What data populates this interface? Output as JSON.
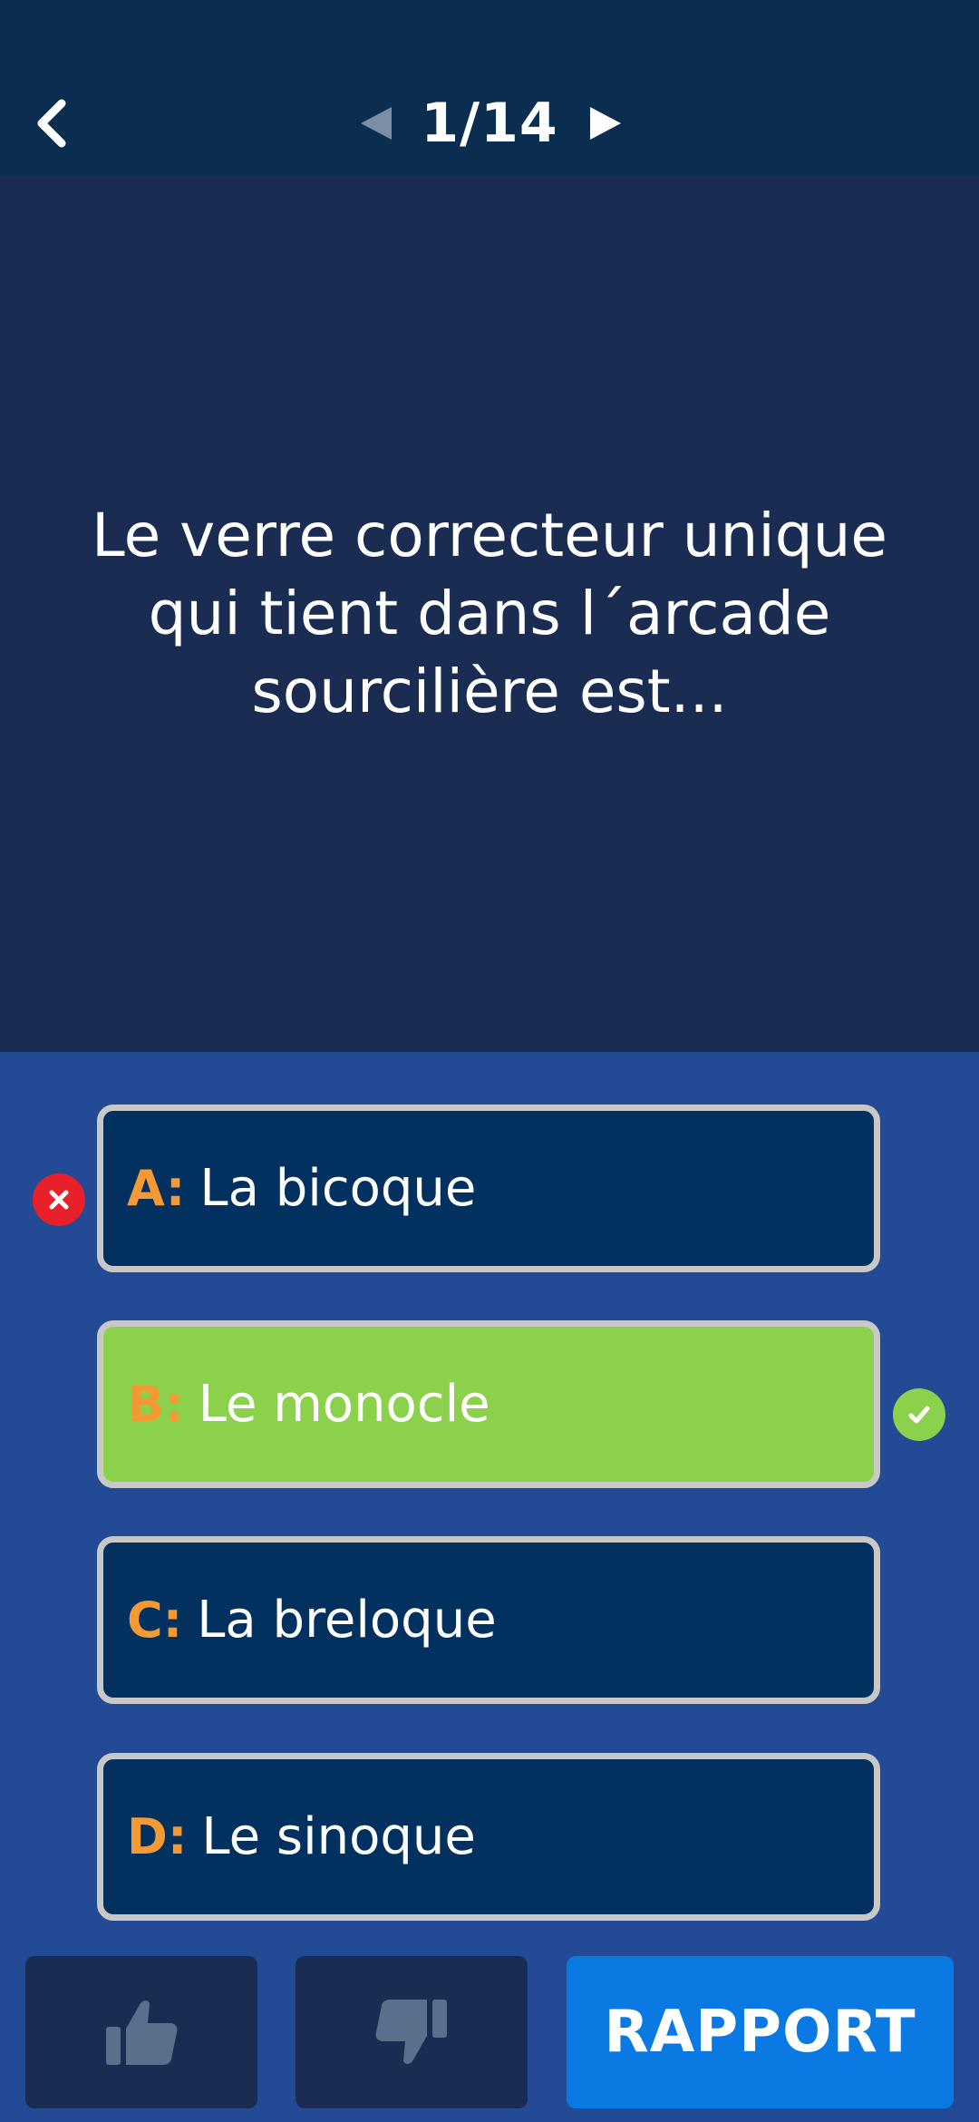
{
  "header": {
    "pager": "1/14"
  },
  "question": {
    "text": "Le verre correcteur unique qui tient dans l´arcade sourcilière est..."
  },
  "answers": [
    {
      "letter": "A:",
      "text": "La bicoque",
      "state": "wrong"
    },
    {
      "letter": "B:",
      "text": "Le monocle",
      "state": "correct"
    },
    {
      "letter": "C:",
      "text": "La breloque",
      "state": "neutral"
    },
    {
      "letter": "D:",
      "text": "Le sinoque",
      "state": "neutral"
    }
  ],
  "footer": {
    "report_label": "RAPPORT"
  },
  "colors": {
    "header_bg": "#0a2d50",
    "question_bg": "#1b2c52",
    "answers_bg": "#234a94",
    "answer_bg": "#02315f",
    "correct_bg": "#8cd14c",
    "wrong_mark": "#e8202a",
    "letter": "#f39a35",
    "report_bg": "#0a7ae2"
  },
  "icons": [
    "chevron-left-icon",
    "triangle-left-icon",
    "triangle-right-icon",
    "x-icon",
    "check-icon",
    "thumbs-up-icon",
    "thumbs-down-icon"
  ]
}
